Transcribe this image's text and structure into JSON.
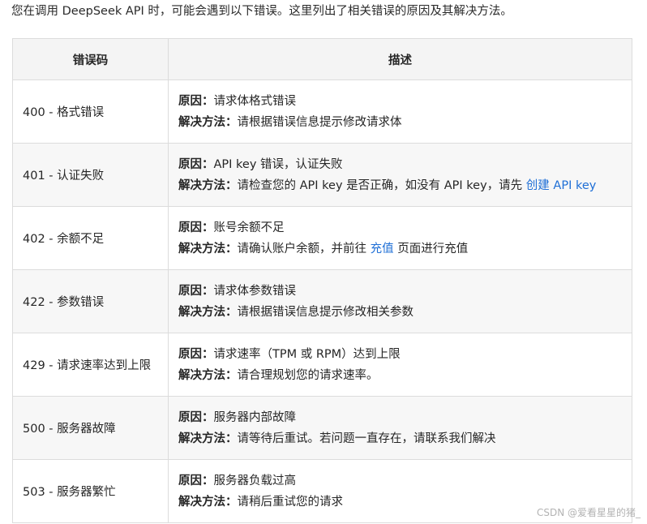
{
  "intro": "您在调用 DeepSeek API 时，可能会遇到以下错误。这里列出了相关错误的原因及其解决方法。",
  "table": {
    "headers": [
      "错误码",
      "描述"
    ],
    "cause_label": "原因",
    "solution_label": "解决方法",
    "colon": "：",
    "rows": [
      {
        "code": "400 - 格式错误",
        "cause": "请求体格式错误",
        "solution": "请根据错误信息提示修改请求体"
      },
      {
        "code": "401 - 认证失败",
        "cause": "API key 错误，认证失败",
        "solution": "请检查您的 API key 是否正确，如没有 API key，请先 ",
        "solution_link": "创建 API key",
        "solution_after": ""
      },
      {
        "code": "402 - 余额不足",
        "cause": "账号余额不足",
        "solution": "请确认账户余额，并前往 ",
        "solution_link": "充值",
        "solution_after": " 页面进行充值"
      },
      {
        "code": "422 - 参数错误",
        "cause": "请求体参数错误",
        "solution": "请根据错误信息提示修改相关参数"
      },
      {
        "code": "429 - 请求速率达到上限",
        "cause": "请求速率（TPM 或 RPM）达到上限",
        "solution": "请合理规划您的请求速率。"
      },
      {
        "code": "500 - 服务器故障",
        "cause": "服务器内部故障",
        "solution": "请等待后重试。若问题一直存在，请联系我们解决"
      },
      {
        "code": "503 - 服务器繁忙",
        "cause": "服务器负载过高",
        "solution": "请稍后重试您的请求"
      }
    ]
  },
  "watermark": "CSDN @爱看星星的猪_",
  "colors": {
    "link": "#1f6fd6",
    "header_bg": "#f4f4f4",
    "stripe_bg": "#f7f7f7",
    "border": "#dcdcdc"
  }
}
